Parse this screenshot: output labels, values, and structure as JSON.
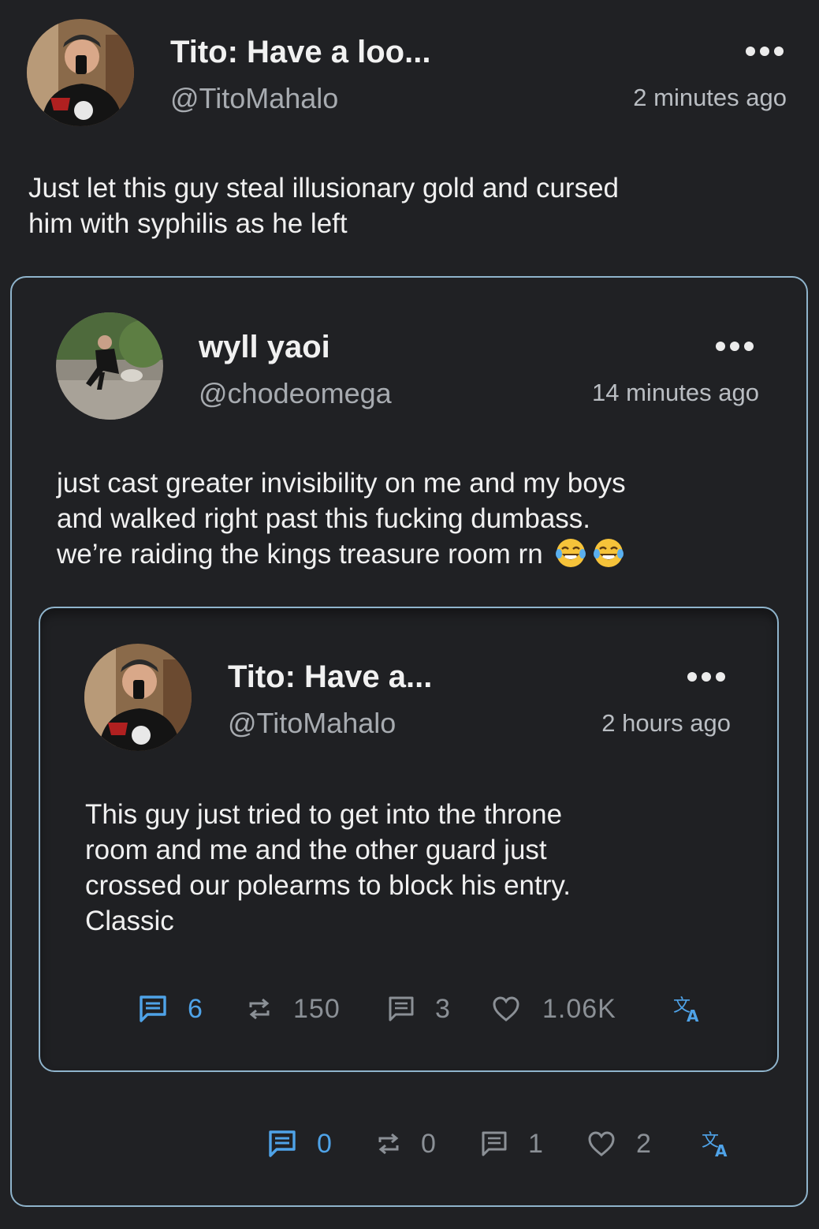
{
  "post": {
    "author_name": "Tito: Have a loo...",
    "handle": "@TitoMahalo",
    "time": "2 minutes ago",
    "text_line1": "Just let this guy steal illusionary gold and cursed",
    "text_line2": "him with syphilis as he left",
    "actions": {
      "comments": "0",
      "boosts": "0",
      "quotes": "1",
      "likes": "2"
    }
  },
  "quote": {
    "author_name": "wyll yaoi",
    "handle": "@chodeomega",
    "time": "14 minutes ago",
    "text_line1": "just cast greater invisibility on me and my boys",
    "text_line2": "and walked right past this fucking dumbass.",
    "text_line3": "we’re raiding the kings treasure room rn",
    "emojis": [
      "😂",
      "😂"
    ]
  },
  "nested_quote": {
    "author_name": "Tito: Have a...",
    "handle": "@TitoMahalo",
    "time": "2 hours ago",
    "text_line1": "This guy just tried to get into the throne",
    "text_line2": "room and me and the other guard just",
    "text_line3": "crossed our polearms to block his entry.",
    "text_line4": "Classic",
    "actions": {
      "comments": "6",
      "boosts": "150",
      "quotes": "3",
      "likes": "1.06K"
    }
  },
  "icons": {
    "comment": "comment-icon",
    "boost": "boost-icon",
    "quote": "quote-icon",
    "like": "heart-icon",
    "translate": "translate-icon",
    "more": "more-options-icon"
  },
  "colors": {
    "background": "#202124",
    "accent": "#4fa3e8",
    "card_border": "#8fb4cc",
    "muted": "#8b9096"
  }
}
